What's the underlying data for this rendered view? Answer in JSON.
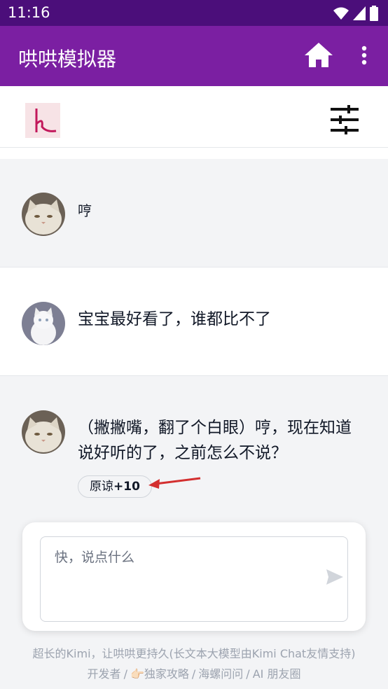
{
  "status_bar": {
    "time": "11:16"
  },
  "app_bar": {
    "title": "哄哄模拟器"
  },
  "messages": [
    {
      "text": "哼"
    },
    {
      "text": "宝宝最好看了，谁都比不了"
    },
    {
      "text": "（撇撇嘴，翻了个白眼）哼，现在知道说好听的了，之前怎么不说？",
      "badge_label": "原谅",
      "badge_value": "+10"
    }
  ],
  "input": {
    "placeholder": "快，说点什么"
  },
  "footer": {
    "tagline": "超长的Kimi，让哄哄更持久(长文本大模型由Kimi Chat友情支持)",
    "links": [
      {
        "label": "开发者"
      },
      {
        "label": "👉🏻独家攻略"
      },
      {
        "label": "海螺问问"
      },
      {
        "label": "AI 朋友圈"
      }
    ],
    "separator": "/"
  },
  "colors": {
    "status_bar": "#4b0e7a",
    "app_bar": "#7b1fa2",
    "annotation_arrow": "#d32f2f"
  }
}
